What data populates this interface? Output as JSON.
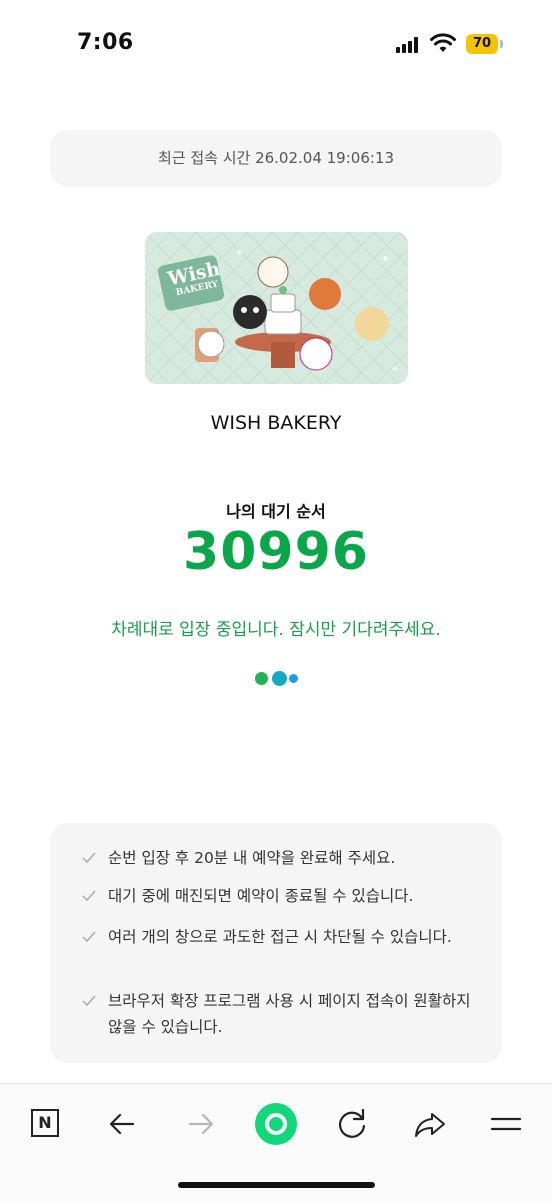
{
  "status_bar": {
    "time": "7:06",
    "battery": "70"
  },
  "last_access": {
    "label": "최근 접속 시간 26.02.04 19:06:13"
  },
  "event": {
    "card_logo": "Wish",
    "card_logo_sub": "BAKERY",
    "title": "WISH BAKERY"
  },
  "queue": {
    "label": "나의 대기 순서",
    "number": "30996",
    "message": "차례대로 입장 중입니다. 잠시만 기다려주세요."
  },
  "notices": [
    "순번 입장 후 20분 내 예약을 완료해 주세요.",
    "대기 중에 매진되면 예약이 종료될 수 있습니다.",
    "여러 개의 창으로 과도한 접근 시 차단될 수 있습니다.",
    "브라우저 확장 프로그램 사용 시 페이지 접속이 원활하지 않을 수 있습니다."
  ],
  "toolbar": {
    "home_letter": "N",
    "icons": [
      "naver-home-icon",
      "back-arrow-icon",
      "forward-arrow-icon",
      "green-dot-icon",
      "reload-icon",
      "share-icon",
      "menu-icon"
    ]
  },
  "colors": {
    "accent": "#0aa64a",
    "message": "#16a04a",
    "card_bg": "#d7eadf",
    "battery": "#f5c400"
  }
}
